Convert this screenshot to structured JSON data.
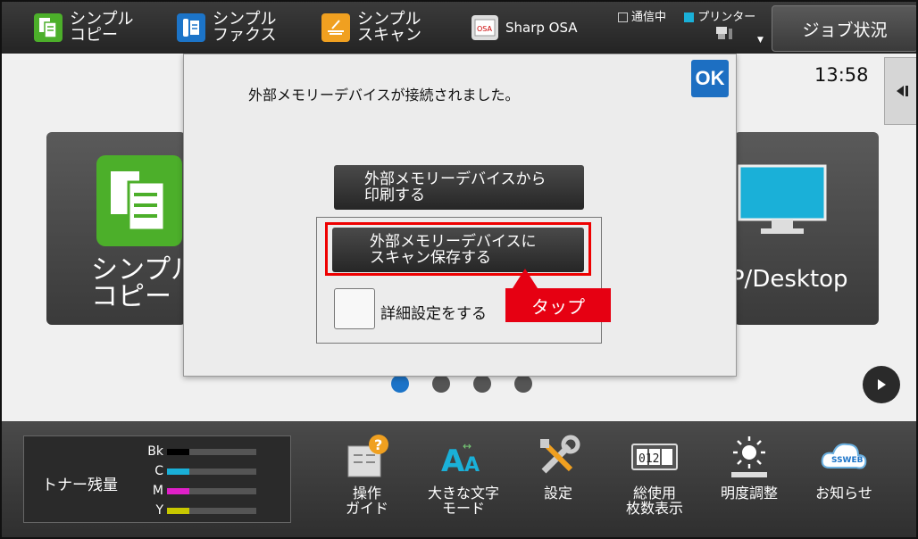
{
  "topbar": {
    "items": [
      {
        "label": "シンプル\nコピー",
        "icon": "copy-icon",
        "color": "#4caf2a"
      },
      {
        "label": "シンプル\nファクス",
        "icon": "fax-icon",
        "color": "#1c74c8"
      },
      {
        "label": "シンプル\nスキャン",
        "icon": "scan-icon",
        "color": "#f0a020"
      },
      {
        "label": "Sharp OSA",
        "icon": "osa-icon"
      }
    ],
    "status_comm": "通信中",
    "status_printer": "プリンター",
    "job_status": "ジョブ状況"
  },
  "main": {
    "clock": "13:58",
    "tile_left_title": "シンプル\nコピー",
    "tile_right_title": "TP/Desktop",
    "page_dots": 4,
    "active_dot": 0
  },
  "modal": {
    "message": "外部メモリーデバイスが接続されました。",
    "ok_label": "OK",
    "print_button": "外部メモリーデバイスから\n印刷する",
    "scan_button": "外部メモリーデバイスに\nスキャン保存する",
    "detail_checkbox_label": "詳細設定をする",
    "tap_callout": "タップ"
  },
  "bottombar": {
    "toner_title": "トナー残量",
    "toner": [
      {
        "label": "Bk",
        "level": 0.25,
        "color": "#000000"
      },
      {
        "label": "C",
        "level": 0.25,
        "color": "#1ab0d8"
      },
      {
        "label": "M",
        "level": 0.25,
        "color": "#e020c8"
      },
      {
        "label": "Y",
        "level": 0.25,
        "color": "#c8c800"
      }
    ],
    "items": [
      {
        "label": "操作\nガイド",
        "icon": "guide-icon"
      },
      {
        "label": "大きな文字\nモード",
        "icon": "large-text-icon"
      },
      {
        "label": "設定",
        "icon": "settings-icon"
      },
      {
        "label": "総使用\n枚数表示",
        "icon": "counter-icon",
        "counter": "012"
      },
      {
        "label": "明度調整",
        "icon": "brightness-icon"
      },
      {
        "label": "お知らせ",
        "icon": "notice-icon",
        "badge": "SSWEB"
      }
    ]
  }
}
